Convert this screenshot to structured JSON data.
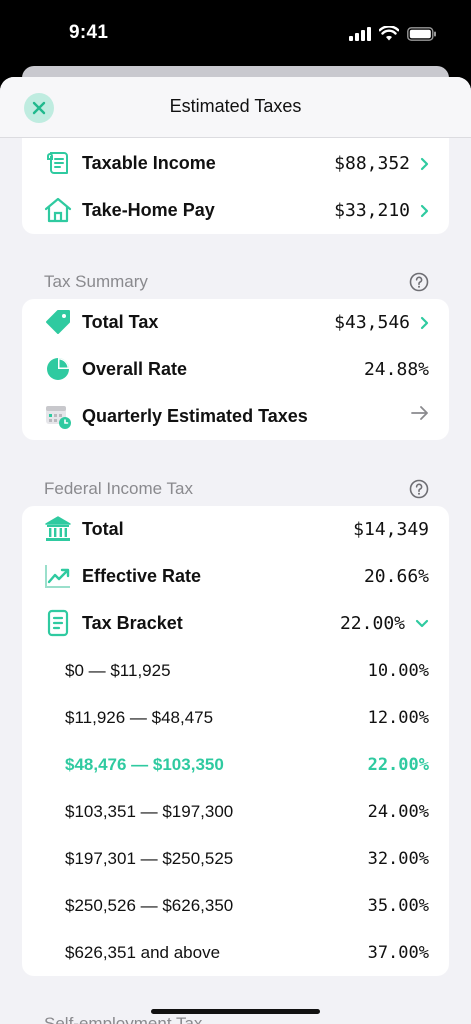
{
  "status": {
    "time": "9:41"
  },
  "nav": {
    "title": "Estimated Taxes"
  },
  "top_card": {
    "rows": [
      {
        "label": "Taxable Income",
        "value": "$88,352"
      },
      {
        "label": "Take-Home Pay",
        "value": "$33,210"
      }
    ]
  },
  "tax_summary": {
    "header": "Tax Summary",
    "rows": [
      {
        "label": "Total Tax",
        "value": "$43,546"
      },
      {
        "label": "Overall Rate",
        "value": "24.88%"
      },
      {
        "label": "Quarterly Estimated Taxes",
        "value": ""
      }
    ]
  },
  "federal": {
    "header": "Federal Income Tax",
    "rows": [
      {
        "label": "Total",
        "value": "$14,349"
      },
      {
        "label": "Effective Rate",
        "value": "20.66%"
      },
      {
        "label": "Tax Bracket",
        "value": "22.00%"
      }
    ],
    "brackets": [
      {
        "range": "$0 — $11,925",
        "rate": "10.00%"
      },
      {
        "range": "$11,926 — $48,475",
        "rate": "12.00%"
      },
      {
        "range": "$48,476 — $103,350",
        "rate": "22.00%"
      },
      {
        "range": "$103,351 — $197,300",
        "rate": "24.00%"
      },
      {
        "range": "$197,301 — $250,525",
        "rate": "32.00%"
      },
      {
        "range": "$250,526 — $626,350",
        "rate": "35.00%"
      },
      {
        "range": "$626,351 and above",
        "rate": "37.00%"
      }
    ],
    "active_bracket_index": 2
  },
  "next_section": {
    "header": "Self-employment Tax"
  },
  "colors": {
    "accent": "#2fcaa0",
    "accent_light": "#bfece0",
    "background": "#f2f2f6",
    "secondary_text": "#8a8a8e"
  },
  "icons": [
    "close-icon",
    "receipt-icon",
    "home-icon",
    "help-icon",
    "tag-icon",
    "pie-chart-icon",
    "calendar-clock-icon",
    "arrow-right-icon",
    "bank-icon",
    "trend-chart-icon",
    "document-icon",
    "chevron-right-icon",
    "chevron-down-icon"
  ]
}
